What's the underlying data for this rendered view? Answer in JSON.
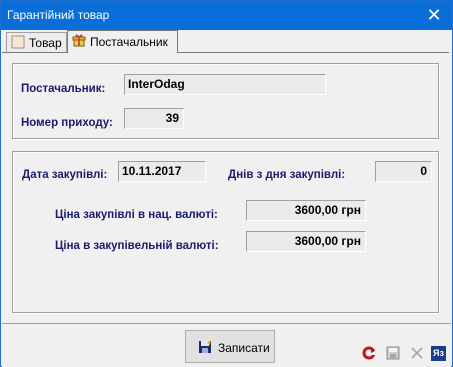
{
  "window": {
    "title": "Гарантійний товар"
  },
  "tabs": [
    {
      "label": "Товар",
      "icon": "box-icon"
    },
    {
      "label": "Постачальник",
      "icon": "gift-icon"
    }
  ],
  "supplier": {
    "supplier_label": "Постачальник:",
    "supplier_value": "InterOdag",
    "receipt_label": "Номер приходу:",
    "receipt_value": "39"
  },
  "purchase": {
    "date_label": "Дата закупівлі:",
    "date_value": "10.11.2017",
    "days_label": "Днів з дня закупівлі:",
    "days_value": "0",
    "price_national_label": "Ціна закупівлі в нац. валюті:",
    "price_national_value": "3600,00 грн",
    "price_purchase_label": "Ціна в закупівельній валюті:",
    "price_purchase_value": "3600,00 грн"
  },
  "footer": {
    "save_label": "Записати",
    "lang_badge": "Яз"
  }
}
